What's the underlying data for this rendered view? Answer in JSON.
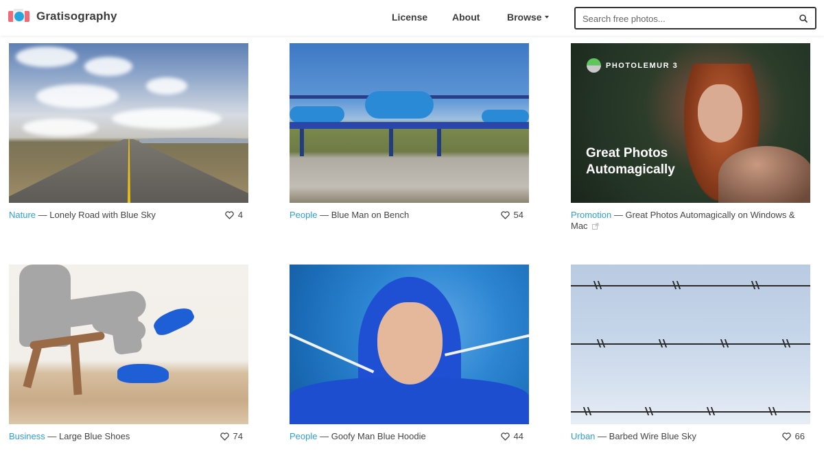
{
  "header": {
    "brand": "Gratisography",
    "nav": [
      {
        "label": "License"
      },
      {
        "label": "About"
      },
      {
        "label": "Browse",
        "has_dropdown": true
      }
    ],
    "search": {
      "placeholder": "Search free photos...",
      "value": "",
      "icon": "search-icon"
    }
  },
  "colors": {
    "category_link": "#2d9fd8",
    "logo_red": "#f06b78",
    "logo_blue": "#23a6e0",
    "text": "#444444"
  },
  "photos": [
    {
      "category": "Nature",
      "separator": " — ",
      "title": "Lonely Road with Blue Sky",
      "likes": "4",
      "icon": "heart-icon"
    },
    {
      "category": "People",
      "separator": " — ",
      "title": "Blue Man on Bench",
      "likes": "54",
      "icon": "heart-icon"
    },
    {
      "category": "Promotion",
      "separator": " — ",
      "title": "Great Photos Automagically on Windows & Mac",
      "external": true,
      "ad": {
        "brand": "PHOTOLEMUR 3",
        "headline_line1": "Great Photos",
        "headline_line2": "Automagically"
      }
    },
    {
      "category": "Business",
      "separator": " — ",
      "title": "Large Blue Shoes",
      "likes": "74",
      "icon": "heart-icon"
    },
    {
      "category": "People",
      "separator": " — ",
      "title": "Goofy Man Blue Hoodie",
      "likes": "44",
      "icon": "heart-icon"
    },
    {
      "category": "Urban",
      "separator": " — ",
      "title": "Barbed Wire Blue Sky",
      "likes": "66",
      "icon": "heart-icon"
    }
  ]
}
